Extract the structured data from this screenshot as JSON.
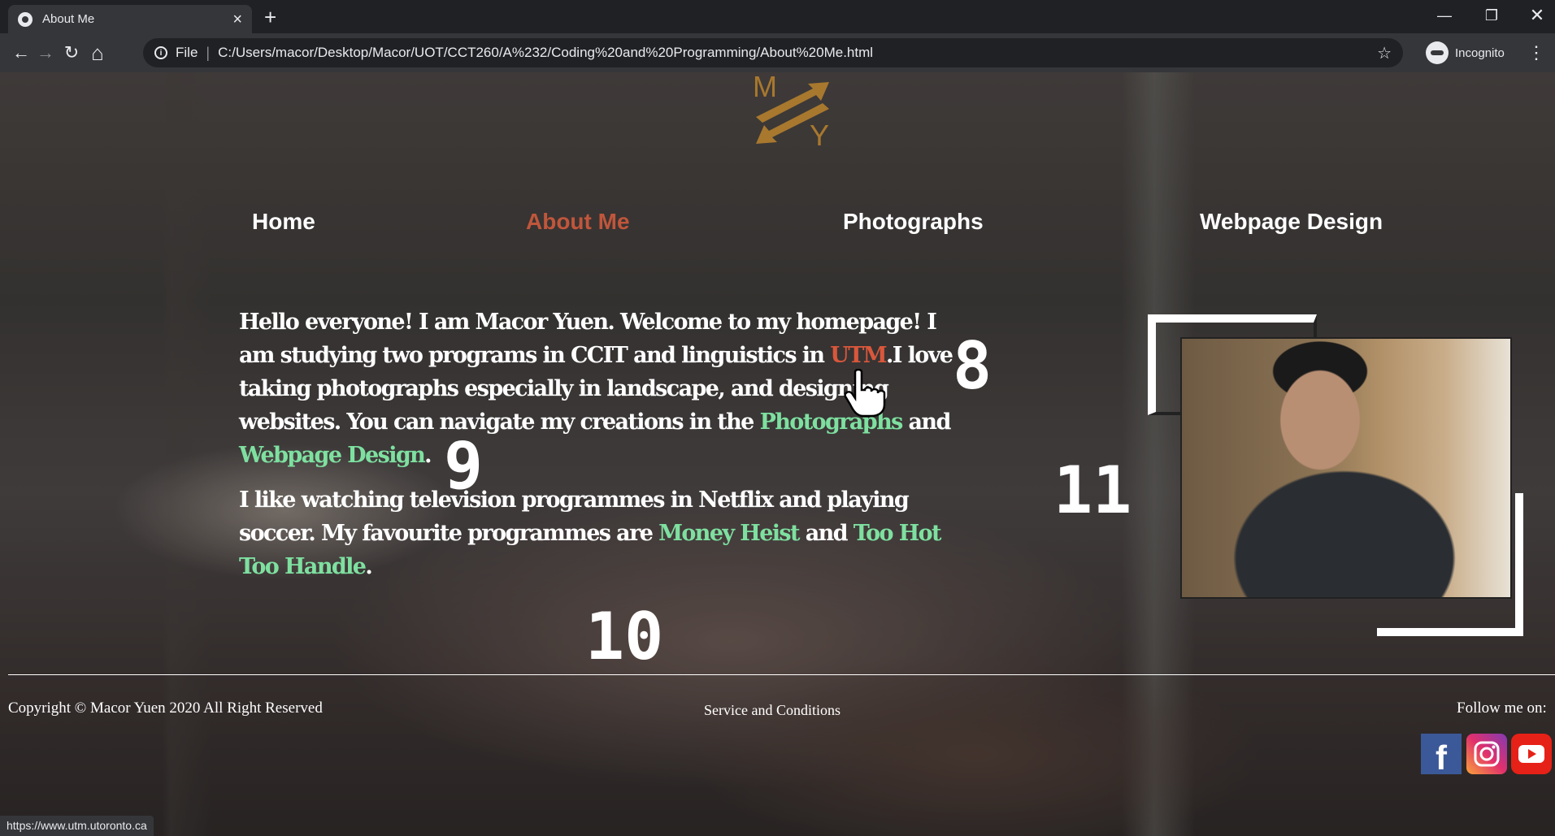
{
  "browser": {
    "tab_title": "About Me",
    "tab_close": "×",
    "new_tab": "+",
    "window_min": "—",
    "window_max": "❐",
    "window_close": "✕",
    "back": "←",
    "forward": "→",
    "reload": "↻",
    "home": "⌂",
    "scheme": "File",
    "separator": "|",
    "url": "C:/Users/macor/Desktop/Macor/UOT/CCT260/A%232/Coding%20and%20Programming/About%20Me.html",
    "star": "☆",
    "incognito_label": "Incognito",
    "menu": "⋮",
    "status_url": "https://www.utm.utoronto.ca"
  },
  "logo": {
    "letter_top": "M",
    "letter_bottom": "Y",
    "color": "#a8782e"
  },
  "nav": {
    "home": "Home",
    "about": "About Me",
    "photographs": "Photographs",
    "webdesign": "Webpage Design"
  },
  "bio": {
    "p1_a": "Hello everyone! I am Macor Yuen. Welcome to my homepage! I am studying two programs in CCIT and linguistics in ",
    "p1_link_utm": "UTM",
    "p1_b": ".I love taking photographs especially in landscape, and designing websites. You can navigate my creations in the ",
    "p1_link_photos": "Photographs",
    "p1_c": " and ",
    "p1_link_web": "Webpage Design",
    "p1_d": ".",
    "p2_a": "I like watching television programmes in Netflix and playing soccer. My favourite programmes are ",
    "p2_link_money": "Money Heist",
    "p2_b": " and ",
    "p2_link_hot": "Too Hot Too Handle",
    "p2_c": "."
  },
  "annotations": {
    "n8": "8",
    "n9": "9",
    "n10": "10",
    "n11": "11"
  },
  "footer": {
    "copyright": "Copyright © Macor Yuen 2020 All Right Reserved",
    "terms": "Service and Conditions",
    "follow": "Follow me on:",
    "facebook_icon": "f",
    "instagram_icon": "instagram",
    "youtube_icon": "youtube"
  },
  "colors": {
    "active_nav": "#c0563b",
    "link_red": "#d9573b",
    "link_green": "#7ee0a0"
  }
}
